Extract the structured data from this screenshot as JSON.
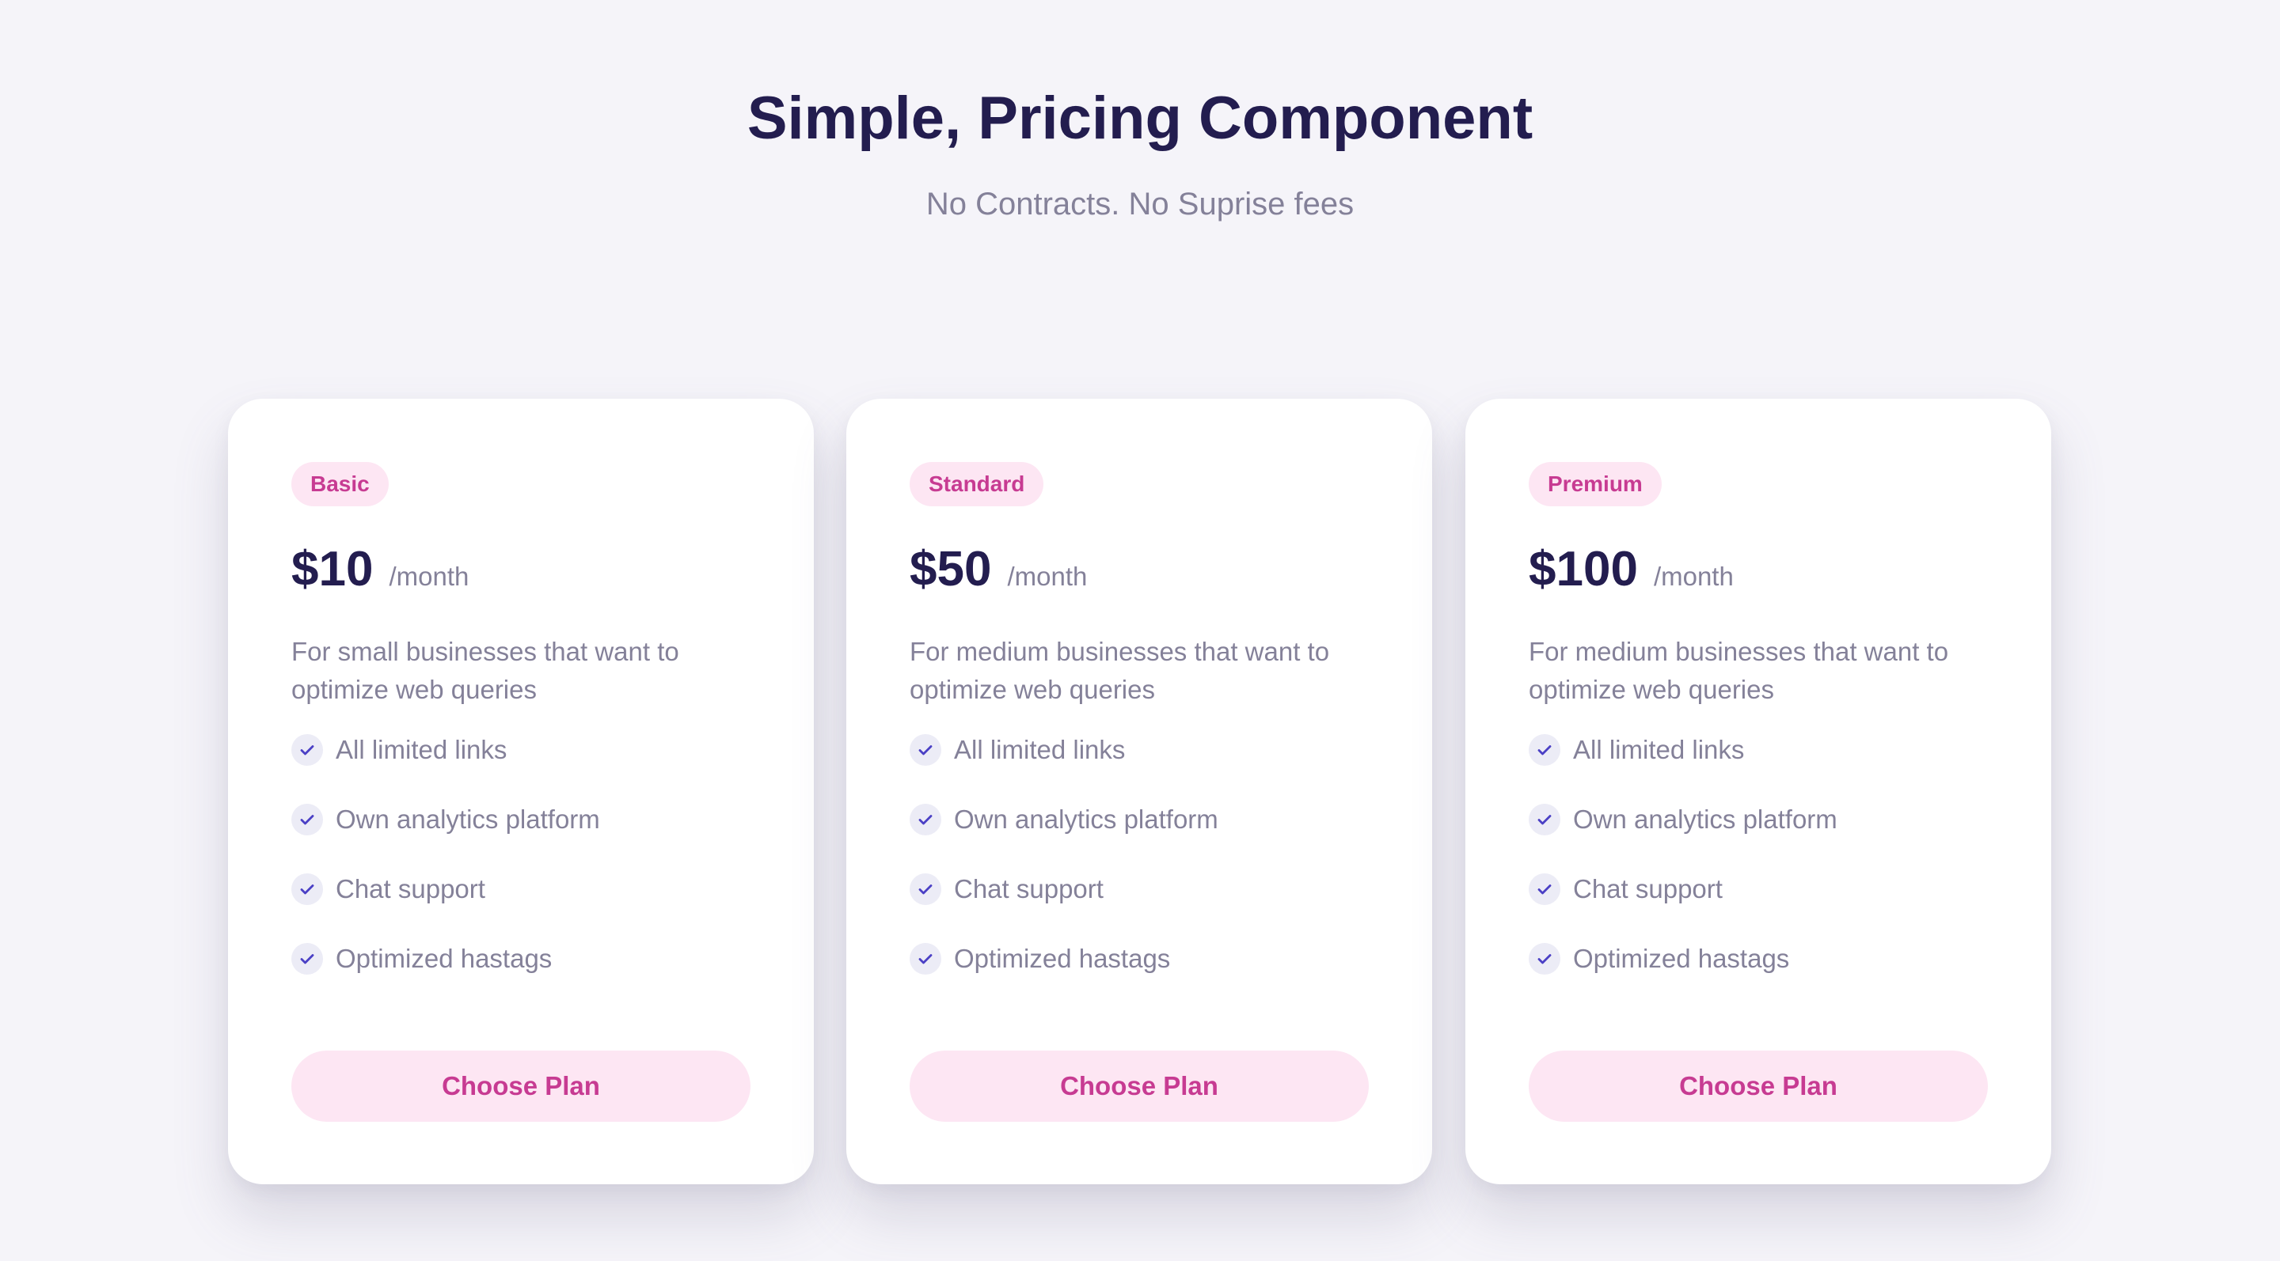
{
  "header": {
    "title": "Simple, Pricing Component",
    "subtitle": "No Contracts. No Suprise fees"
  },
  "plans": [
    {
      "badge": "Basic",
      "price": "$10",
      "period": "/month",
      "description": "For small businesses that want to optimize web queries",
      "features": [
        "All limited links",
        "Own analytics platform",
        "Chat support",
        "Optimized hastags"
      ],
      "cta": "Choose Plan"
    },
    {
      "badge": "Standard",
      "price": "$50",
      "period": "/month",
      "description": "For medium businesses that want to optimize web queries",
      "features": [
        "All limited links",
        "Own analytics platform",
        "Chat support",
        "Optimized hastags"
      ],
      "cta": "Choose Plan"
    },
    {
      "badge": "Premium",
      "price": "$100",
      "period": "/month",
      "description": "For medium businesses that want to optimize web queries",
      "features": [
        "All limited links",
        "Own analytics platform",
        "Chat support",
        "Optimized hastags"
      ],
      "cta": "Choose Plan"
    }
  ],
  "icons": {
    "feature": "check-icon"
  },
  "colors": {
    "background": "#f5f4f9",
    "heading": "#231d4f",
    "muted": "#848199",
    "accent": "#c73b92",
    "accent_bg": "#fde6f3",
    "check": "#4b40c5",
    "check_bg": "#ececf6"
  }
}
